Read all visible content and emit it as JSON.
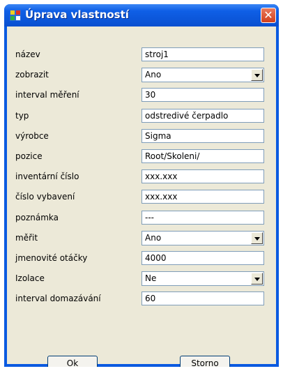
{
  "window": {
    "title": "Úprava vlastností",
    "close_glyph": "✕"
  },
  "fields": [
    {
      "label": "název",
      "value": "stroj1",
      "type": "text"
    },
    {
      "label": "zobrazit",
      "value": "Ano",
      "type": "select"
    },
    {
      "label": "interval měření",
      "value": "30",
      "type": "text"
    },
    {
      "label": "typ",
      "value": "odstredivé čerpadlo",
      "type": "text"
    },
    {
      "label": "výrobce",
      "value": "Sigma",
      "type": "text"
    },
    {
      "label": "pozice",
      "value": "Root/Skoleni/",
      "type": "text"
    },
    {
      "label": "inventární číslo",
      "value": "xxx.xxx",
      "type": "text"
    },
    {
      "label": "číslo vybavení",
      "value": "xxx.xxx",
      "type": "text"
    },
    {
      "label": "poznámka",
      "value": "---",
      "type": "text"
    },
    {
      "label": "měřit",
      "value": "Ano",
      "type": "select"
    },
    {
      "label": "jmenovité otáčky",
      "value": "4000",
      "type": "text"
    },
    {
      "label": "Izolace",
      "value": "Ne",
      "type": "select"
    },
    {
      "label": "interval domazávání",
      "value": "60",
      "type": "text"
    }
  ],
  "buttons": {
    "ok": {
      "key": "O",
      "rest": "k"
    },
    "storno": {
      "key": "S",
      "rest": "torno"
    }
  },
  "colors": {
    "titlebar": "#0a5ae0",
    "face": "#ece9d8",
    "field_border": "#7f9db9"
  }
}
